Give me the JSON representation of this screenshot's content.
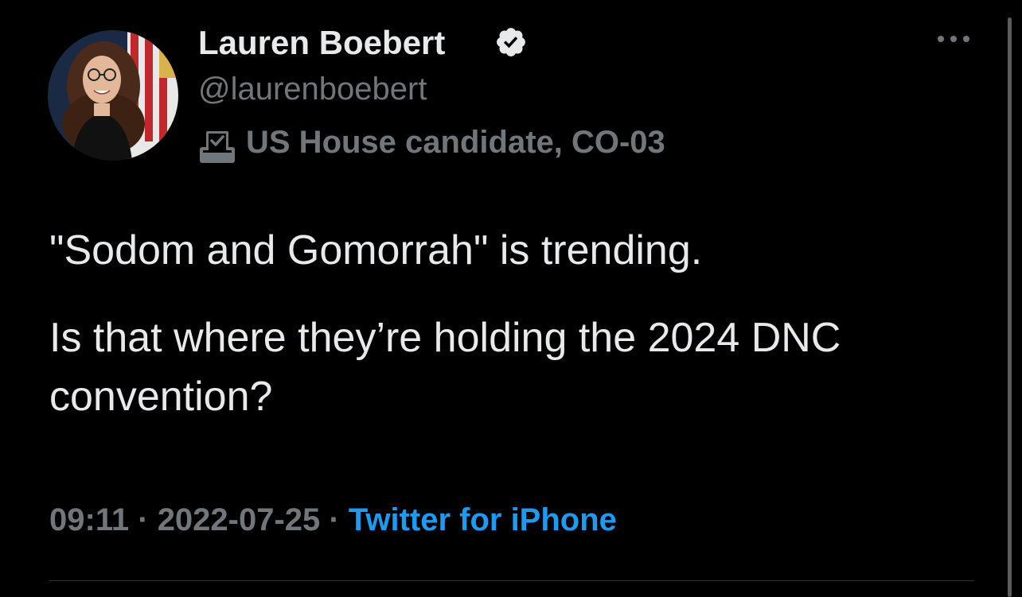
{
  "tweet": {
    "author": {
      "display_name": "Lauren Boebert",
      "handle": "@laurenboebert",
      "verified": true,
      "label_icon": "ballot-box-icon",
      "label": "US House candidate, CO-03"
    },
    "paragraphs": [
      "\"Sodom and Gomorrah\" is trending.",
      "Is that where they’re holding the 2024 DNC convention?"
    ],
    "time": "09:11",
    "separator": "·",
    "date": "2022-07-25",
    "source": "Twitter for iPhone"
  },
  "colors": {
    "background": "#000000",
    "text": "#e7e9ea",
    "muted": "#71767b",
    "link": "#1d9bf0"
  }
}
